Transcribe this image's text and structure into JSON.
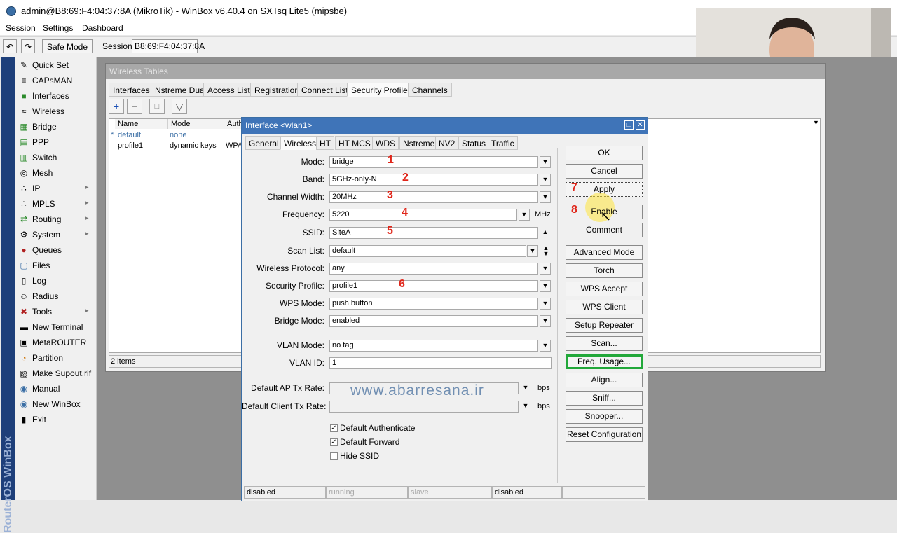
{
  "window": {
    "title": "admin@B8:69:F4:04:37:8A (MikroTik) - WinBox v6.40.4 on SXTsq Lite5 (mipsbe)"
  },
  "menu": [
    "Session",
    "Settings",
    "Dashboard"
  ],
  "toolbar": {
    "undo_icon": "undo-icon",
    "redo_icon": "redo-icon",
    "safe_mode": "Safe Mode",
    "session_label": "Session:",
    "session_value": "B8:69:F4:04:37:8A"
  },
  "sidebar": {
    "vertical_text": "RouterOS WinBox",
    "items": [
      {
        "label": "Quick Set",
        "icon": "quick-set-icon",
        "submenu": false
      },
      {
        "label": "CAPsMAN",
        "icon": "capsman-icon",
        "submenu": false
      },
      {
        "label": "Interfaces",
        "icon": "interfaces-icon",
        "submenu": false
      },
      {
        "label": "Wireless",
        "icon": "wireless-icon",
        "submenu": false
      },
      {
        "label": "Bridge",
        "icon": "bridge-icon",
        "submenu": false
      },
      {
        "label": "PPP",
        "icon": "ppp-icon",
        "submenu": false
      },
      {
        "label": "Switch",
        "icon": "switch-icon",
        "submenu": false
      },
      {
        "label": "Mesh",
        "icon": "mesh-icon",
        "submenu": false
      },
      {
        "label": "IP",
        "icon": "ip-icon",
        "submenu": true
      },
      {
        "label": "MPLS",
        "icon": "mpls-icon",
        "submenu": true
      },
      {
        "label": "Routing",
        "icon": "routing-icon",
        "submenu": true
      },
      {
        "label": "System",
        "icon": "system-icon",
        "submenu": true
      },
      {
        "label": "Queues",
        "icon": "queues-icon",
        "submenu": false
      },
      {
        "label": "Files",
        "icon": "files-icon",
        "submenu": false
      },
      {
        "label": "Log",
        "icon": "log-icon",
        "submenu": false
      },
      {
        "label": "Radius",
        "icon": "radius-icon",
        "submenu": false
      },
      {
        "label": "Tools",
        "icon": "tools-icon",
        "submenu": true
      },
      {
        "label": "New Terminal",
        "icon": "terminal-icon",
        "submenu": false
      },
      {
        "label": "MetaROUTER",
        "icon": "metarouter-icon",
        "submenu": false
      },
      {
        "label": "Partition",
        "icon": "partition-icon",
        "submenu": false
      },
      {
        "label": "Make Supout.rif",
        "icon": "supout-icon",
        "submenu": false
      },
      {
        "label": "Manual",
        "icon": "manual-icon",
        "submenu": false
      },
      {
        "label": "New WinBox",
        "icon": "winbox-icon",
        "submenu": false
      },
      {
        "label": "Exit",
        "icon": "exit-icon",
        "submenu": false
      }
    ]
  },
  "wireless_tables": {
    "title": "Wireless Tables",
    "tabs": [
      "Interfaces",
      "Nstreme Dual",
      "Access List",
      "Registration",
      "Connect List",
      "Security Profiles",
      "Channels"
    ],
    "active_tab": "Security Profiles",
    "columns": [
      "Name",
      "Mode",
      "Auth"
    ],
    "rows": [
      {
        "flag": "*",
        "name": "default",
        "mode": "none",
        "auth": ""
      },
      {
        "flag": "",
        "name": "profile1",
        "mode": "dynamic keys",
        "auth": "WPA"
      }
    ],
    "status": "2 items"
  },
  "interface_dialog": {
    "title": "Interface <wlan1>",
    "tabs": [
      "General",
      "Wireless",
      "HT",
      "HT MCS",
      "WDS",
      "Nstreme",
      "NV2",
      "Status",
      "Traffic"
    ],
    "active_tab": "Wireless",
    "fields": {
      "mode": {
        "label": "Mode:",
        "value": "bridge",
        "marker": "1"
      },
      "band": {
        "label": "Band:",
        "value": "5GHz-only-N",
        "marker": "2"
      },
      "channel_width": {
        "label": "Channel Width:",
        "value": "20MHz",
        "marker": "3"
      },
      "frequency": {
        "label": "Frequency:",
        "value": "5220",
        "unit": "MHz",
        "marker": "4"
      },
      "ssid": {
        "label": "SSID:",
        "value": "SiteA",
        "marker": "5"
      },
      "scan_list": {
        "label": "Scan List:",
        "value": "default"
      },
      "wireless_protocol": {
        "label": "Wireless Protocol:",
        "value": "any"
      },
      "security_profile": {
        "label": "Security Profile:",
        "value": "profile1",
        "marker": "6"
      },
      "wps_mode": {
        "label": "WPS Mode:",
        "value": "push button"
      },
      "bridge_mode": {
        "label": "Bridge Mode:",
        "value": "enabled"
      },
      "vlan_mode": {
        "label": "VLAN Mode:",
        "value": "no tag"
      },
      "vlan_id": {
        "label": "VLAN ID:",
        "value": "1"
      },
      "default_ap_tx_rate": {
        "label": "Default AP Tx Rate:",
        "value": "",
        "unit": "bps"
      },
      "default_client_tx_rate": {
        "label": "Default Client Tx Rate:",
        "value": "",
        "unit": "bps"
      }
    },
    "checkboxes": [
      {
        "label": "Default Authenticate",
        "checked": true
      },
      {
        "label": "Default Forward",
        "checked": true
      },
      {
        "label": "Hide SSID",
        "checked": false
      }
    ],
    "buttons": [
      "OK",
      "Cancel",
      "Apply",
      "Enable",
      "Comment",
      "Advanced Mode",
      "Torch",
      "WPS Accept",
      "WPS Client",
      "Setup Repeater",
      "Scan...",
      "Freq. Usage...",
      "Align...",
      "Sniff...",
      "Snooper...",
      "Reset Configuration"
    ],
    "button_markers": {
      "apply": "7",
      "enable": "8"
    },
    "highlight_color": "#22a83a",
    "status_bar": [
      "disabled",
      "running",
      "slave",
      "disabled",
      ""
    ]
  },
  "watermark": "www.abarresana.ir",
  "colors": {
    "title_blue": "#3f74b8",
    "sidebar_blue": "#1e3f7a",
    "marker_red": "#e0261a"
  }
}
